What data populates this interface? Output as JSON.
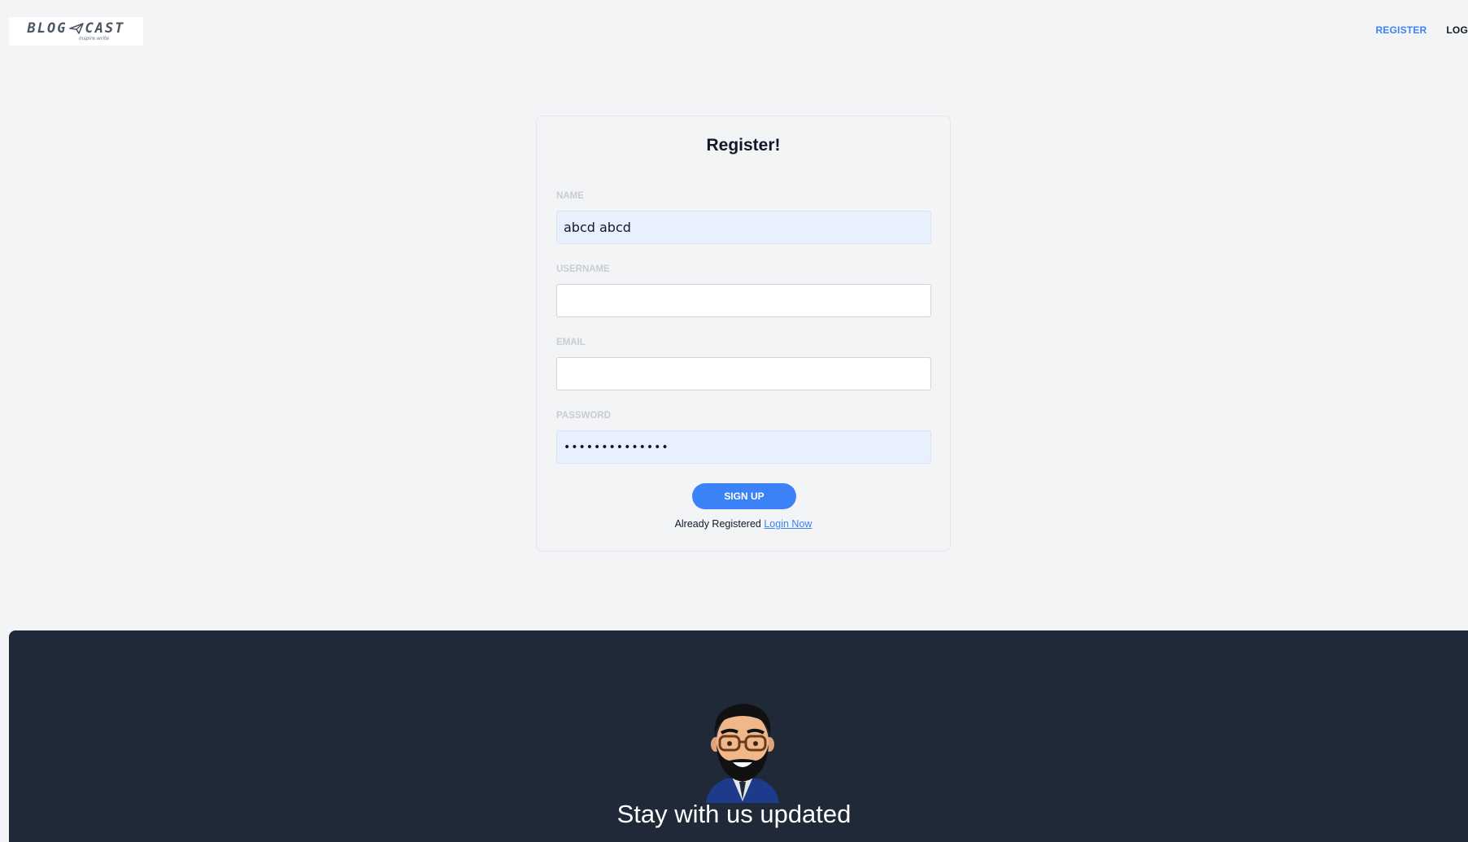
{
  "header": {
    "logo": {
      "brand_left": "BLOG",
      "brand_right": "CAST",
      "tagline": "inspire.write"
    },
    "nav": {
      "register": "REGISTER",
      "login": "LOG"
    }
  },
  "form": {
    "title": "Register!",
    "fields": {
      "name": {
        "label": "NAME",
        "value": "abcd abcd"
      },
      "username": {
        "label": "USERNAME",
        "value": ""
      },
      "email": {
        "label": "EMAIL",
        "value": ""
      },
      "password": {
        "label": "PASSWORD",
        "value": "••••••••••••••"
      }
    },
    "submit_label": "SIGN UP",
    "already_text": "Already Registered",
    "login_link": "Login Now"
  },
  "footer": {
    "heading": "Stay with us updated"
  },
  "colors": {
    "accent": "#3b82f6",
    "page_bg": "#f3f4f6",
    "footer_bg": "#1f2937",
    "autofill_bg": "#e8f0fe"
  }
}
